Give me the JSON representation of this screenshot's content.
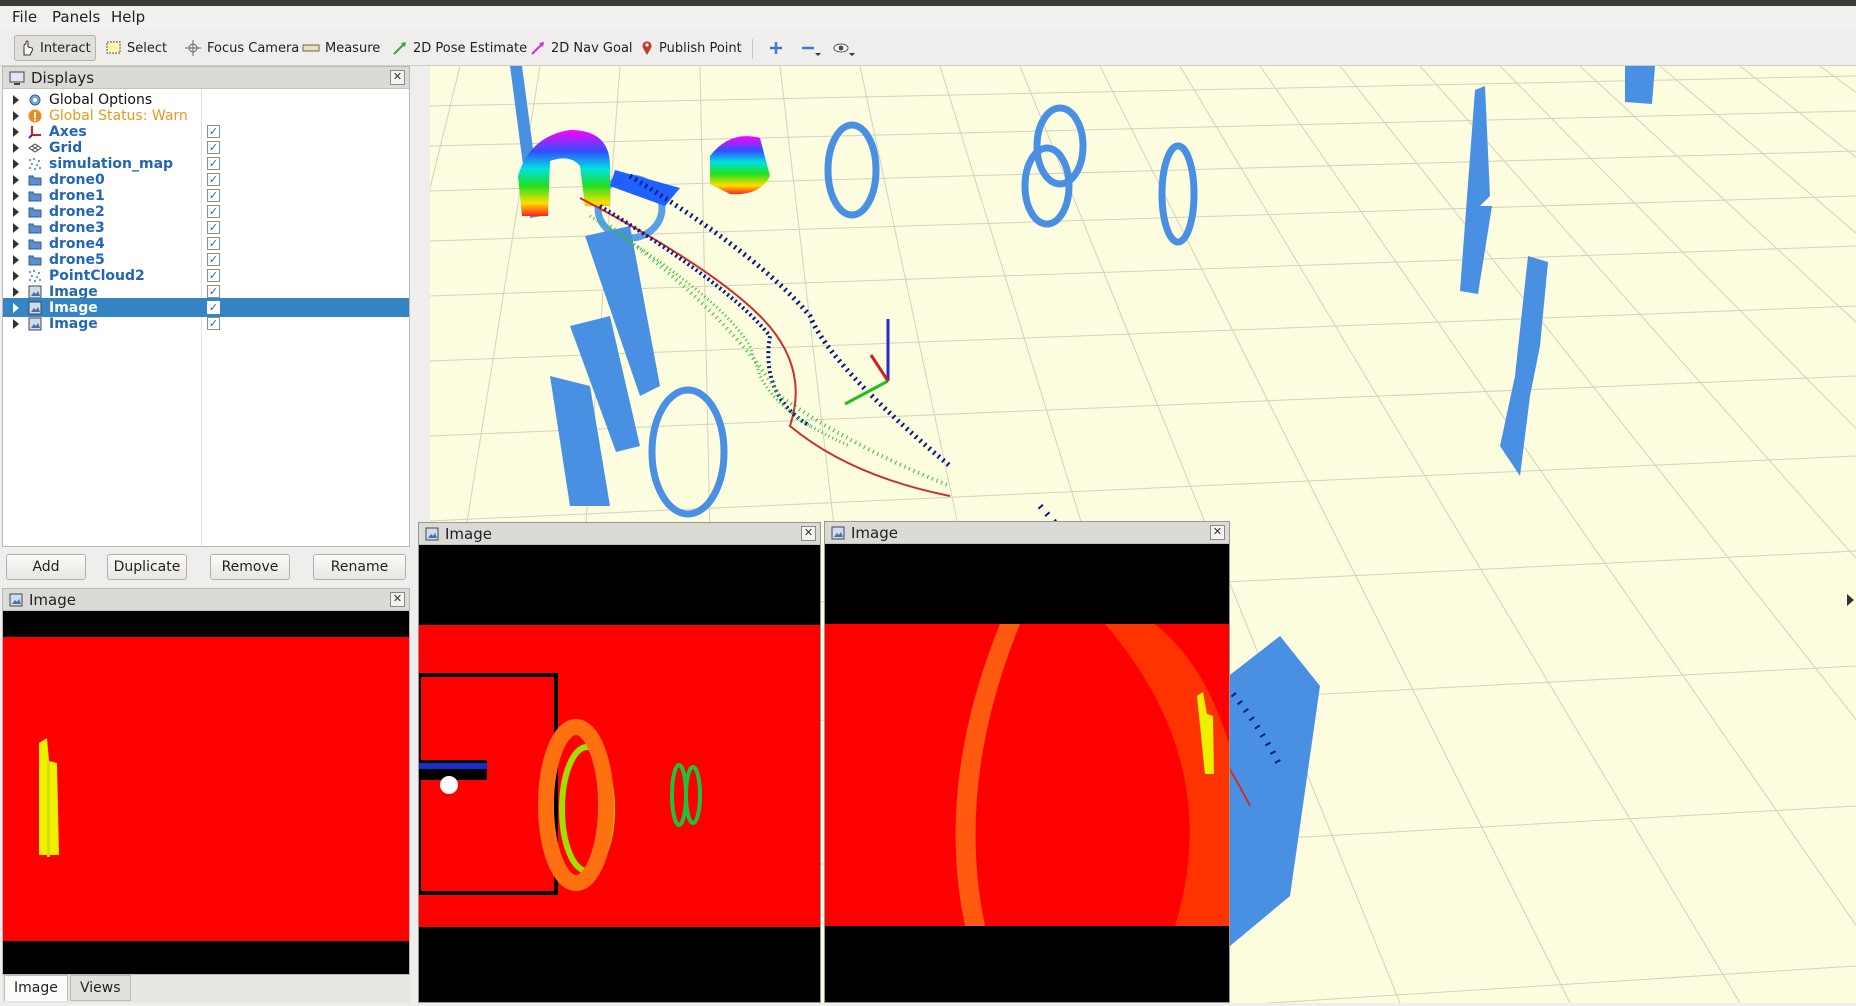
{
  "menu": {
    "file": "File",
    "panels": "Panels",
    "help": "Help"
  },
  "toolbar": {
    "interact": "Interact",
    "select": "Select",
    "focus_camera": "Focus Camera",
    "measure": "Measure",
    "pose_estimate": "2D Pose Estimate",
    "nav_goal": "2D Nav Goal",
    "publish_point": "Publish Point"
  },
  "displays": {
    "title": "Displays",
    "items": [
      {
        "label": "Global Options",
        "style": "plain",
        "icon": "gear-icon",
        "checked": null
      },
      {
        "label": "Global Status: Warn",
        "style": "warn",
        "icon": "warning-icon",
        "checked": null
      },
      {
        "label": "Axes",
        "style": "bold",
        "icon": "axes-icon",
        "checked": "✓"
      },
      {
        "label": "Grid",
        "style": "bold",
        "icon": "grid-icon",
        "checked": "✓"
      },
      {
        "label": "simulation_map",
        "style": "bold",
        "icon": "pointcloud-icon",
        "checked": "✓"
      },
      {
        "label": "drone0",
        "style": "bold",
        "icon": "folder-icon",
        "checked": "✓"
      },
      {
        "label": "drone1",
        "style": "bold",
        "icon": "folder-icon",
        "checked": "✓"
      },
      {
        "label": "drone2",
        "style": "bold",
        "icon": "folder-icon",
        "checked": "✓"
      },
      {
        "label": "drone3",
        "style": "bold",
        "icon": "folder-icon",
        "checked": "✓"
      },
      {
        "label": "drone4",
        "style": "bold",
        "icon": "folder-icon",
        "checked": "✓"
      },
      {
        "label": "drone5",
        "style": "bold",
        "icon": "folder-icon",
        "checked": "✓"
      },
      {
        "label": "PointCloud2",
        "style": "bold",
        "icon": "pointcloud-icon",
        "checked": "✓"
      },
      {
        "label": "Image",
        "style": "bold",
        "icon": "image-icon",
        "checked": "✓"
      },
      {
        "label": "Image",
        "style": "bold",
        "icon": "image-icon",
        "checked": "✓",
        "selected": true
      },
      {
        "label": "Image",
        "style": "bold",
        "icon": "image-icon",
        "checked": "✓"
      }
    ]
  },
  "buttons": {
    "add": "Add",
    "duplicate": "Duplicate",
    "remove": "Remove",
    "rename": "Rename"
  },
  "image_panels": {
    "left": "Image",
    "middle": "Image",
    "right": "Image"
  },
  "bottom_tabs": {
    "image": "Image",
    "views": "Views"
  },
  "close_glyph": "✕",
  "colors": {
    "selection": "#3584c4",
    "label_blue": "#2266b5",
    "warn": "#e89820",
    "viewport_bg": "#fcfcde",
    "obstacle": "#4a90e2",
    "camera_red": "#ff0000"
  }
}
